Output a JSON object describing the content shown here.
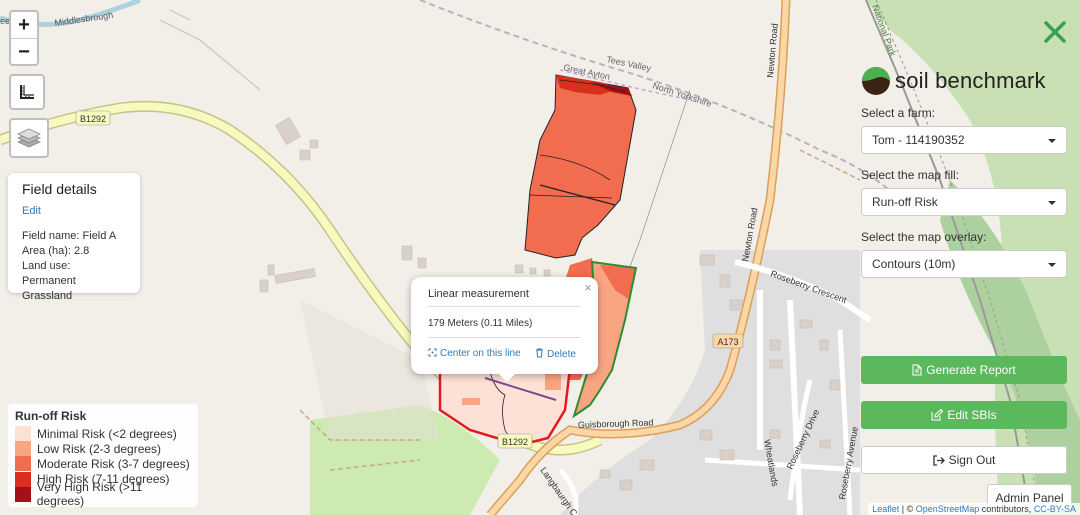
{
  "map": {
    "labels": {
      "middlesbrough": "Middlesbrough",
      "tees_valley": "Tees Valley",
      "great_ayton": "Great Ayton",
      "north_yorkshire": "North Yorkshire",
      "newton_road_1": "Newton Road",
      "newton_road_2": "Newton Road",
      "b1292_1": "B1292",
      "b1292_2": "B1292",
      "a173": "A173",
      "roseberry_crescent": "Roseberry Crescent",
      "roseberry_drive": "Roseberry Drive",
      "wheatlands": "Wheatlands",
      "guisborough_road": "Guisborough Road",
      "langbaurgh": "Langbaurgh C",
      "national_park": "National Park",
      "roseberry_ave": "Roseberry Avenue",
      "edge_label": "ee"
    },
    "colors": {
      "minimal": "#fde0d6",
      "low": "#f9a582",
      "moderate": "#f26c4f",
      "high": "#d7301f",
      "very_high": "#a50f15",
      "selected_outline": "#e31a1c",
      "green_outline": "#2e8b2e"
    }
  },
  "controls": {
    "zoom_in": "+",
    "zoom_out": "−",
    "measure_icon": "ruler-icon",
    "layers_icon": "layers-icon"
  },
  "field_details": {
    "title": "Field details",
    "edit": "Edit",
    "field_name": "Field name: Field A",
    "area": "Area (ha): 2.8",
    "land_use_1": "Land use: Permanent",
    "land_use_2": "Grassland"
  },
  "popup": {
    "title": "Linear measurement",
    "value": "179 Meters (0.11 Miles)",
    "center": "Center on this line",
    "delete": "Delete",
    "close": "×"
  },
  "legend": {
    "title": "Run-off Risk",
    "items": [
      {
        "label": "Minimal Risk (<2 degrees)",
        "color": "#fde0d6"
      },
      {
        "label": "Low Risk (2-3 degrees)",
        "color": "#f9a582"
      },
      {
        "label": "Moderate Risk (3-7 degrees)",
        "color": "#f26c4f"
      },
      {
        "label": "High Risk (7-11 degrees)",
        "color": "#d7301f"
      },
      {
        "label": "Very High Risk (>11 degrees)",
        "color": "#a50f15"
      }
    ]
  },
  "panel": {
    "brand": "soil benchmark",
    "farm_label": "Select a farm:",
    "farm_value": "Tom - 114190352",
    "fill_label": "Select the map fill:",
    "fill_value": "Run-off Risk",
    "overlay_label": "Select the map overlay:",
    "overlay_value": "Contours (10m)",
    "generate_report": "Generate Report",
    "edit_sbis": "Edit SBIs",
    "sign_out": "Sign Out",
    "admin_panel": "Admin Panel",
    "accent": "#5cb85c"
  },
  "attribution": {
    "leaflet": "Leaflet",
    "sep": " | © ",
    "osm": "OpenStreetMap",
    "contrib": " contributors, ",
    "license": "CC-BY-SA"
  }
}
